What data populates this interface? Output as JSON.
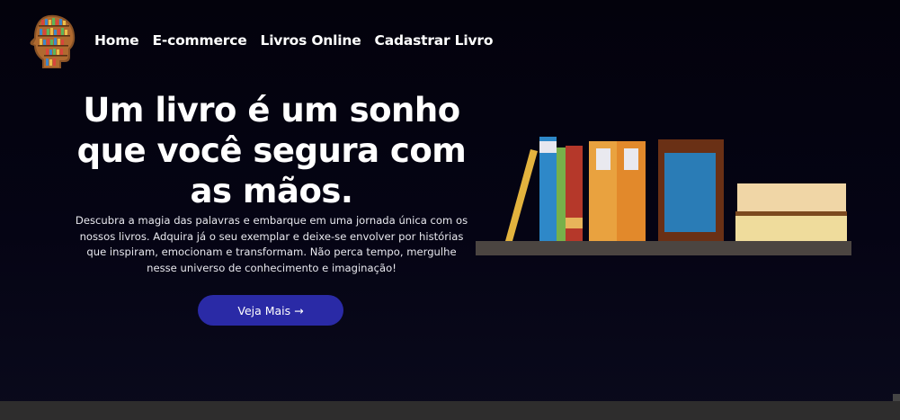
{
  "nav": {
    "items": [
      {
        "label": "Home"
      },
      {
        "label": "E-commerce"
      },
      {
        "label": "Livros Online"
      },
      {
        "label": "Cadastrar Livro"
      }
    ]
  },
  "hero": {
    "title": "Um livro é um sonho que você segura com as mãos.",
    "description": "Descubra a magia das palavras e embarque em uma jornada única com os nossos livros. Adquira já o seu exemplar e deixe-se envolver por histórias que inspiram, emocionam e transformam. Não perca tempo, mergulhe nesse universo de conhecimento e imaginação!",
    "cta_label": "Veja Mais →"
  },
  "icons": {
    "logo": "head-bookshelf-logo-icon",
    "illustration": "bookshelf-illustration"
  },
  "colors": {
    "background": "#050414",
    "button": "#2a2aa6",
    "text": "#ffffff",
    "footer": "#2e2d2d"
  }
}
